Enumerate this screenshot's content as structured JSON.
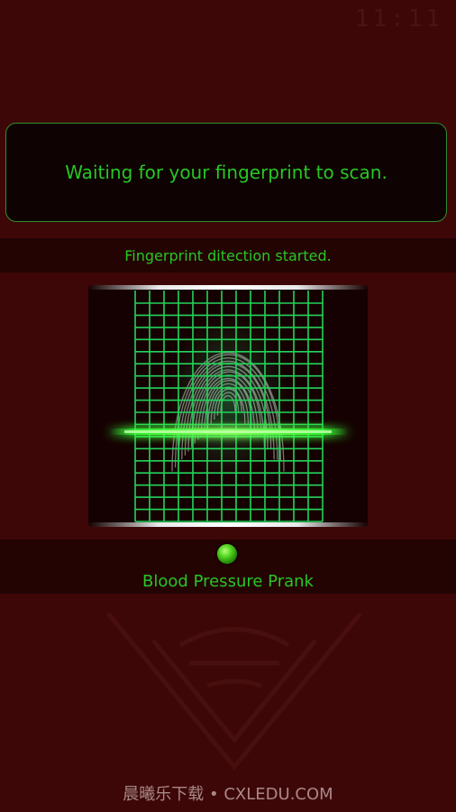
{
  "status_bar": {
    "clock": "11:11"
  },
  "message": {
    "text": "Waiting for your fingerprint to scan."
  },
  "detection": {
    "text": "Fingerprint ditection started."
  },
  "scanner": {
    "fingerprint": "fingerprint-icon"
  },
  "indicator": {
    "color": "#4fd41e"
  },
  "app": {
    "title": "Blood Pressure Prank"
  },
  "watermark": {
    "text": "晨曦乐下载 • CXLEDU.COM"
  },
  "colors": {
    "background": "#3e0707",
    "accent": "#26c726",
    "panel": "#0e0202"
  }
}
